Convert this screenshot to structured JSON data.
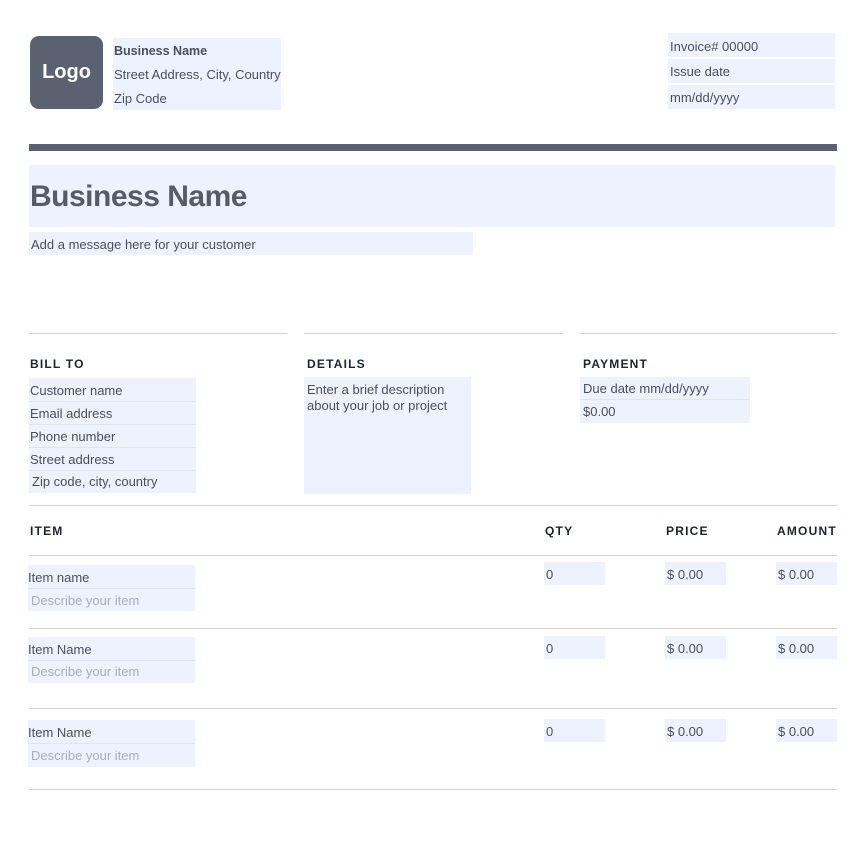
{
  "header": {
    "logo_text": "Logo",
    "business_name": "Business Name",
    "address": "Street Address, City, Country",
    "zip": "Zip Code",
    "invoice_number": "Invoice# 00000",
    "issue_date_label": "Issue date",
    "issue_date_value": "mm/dd/yyyy",
    "accent_color": "#5a6272"
  },
  "title": {
    "business_name": "Business Name",
    "message": "Add a message here for your customer"
  },
  "bill_to": {
    "heading": "BILL TO",
    "customer_name": "Customer name",
    "email": "Email address",
    "phone": "Phone number",
    "street": "Street address",
    "zip_city_country": "Zip code, city, country"
  },
  "details": {
    "heading": "DETAILS",
    "line1": "Enter a brief description",
    "line2": "about your job or project"
  },
  "payment": {
    "heading": "PAYMENT",
    "due_date": "Due date mm/dd/yyyy",
    "amount": "$0.00"
  },
  "items_table": {
    "headers": {
      "item": "ITEM",
      "qty": "QTY",
      "price": "PRICE",
      "amount": "AMOUNT"
    },
    "rows": [
      {
        "name": "Item name",
        "description": "Describe your item",
        "qty": "0",
        "price": "$ 0.00",
        "amount": "$ 0.00"
      },
      {
        "name": "Item Name",
        "description": "Describe your item",
        "qty": "0",
        "price": "$ 0.00",
        "amount": "$ 0.00"
      },
      {
        "name": "Item Name",
        "description": "Describe your item",
        "qty": "0",
        "price": "$ 0.00",
        "amount": "$ 0.00"
      }
    ]
  },
  "colors": {
    "field_background": "#eef1fe",
    "text": "#4a4f5a",
    "placeholder_text": "#a9aebb"
  }
}
